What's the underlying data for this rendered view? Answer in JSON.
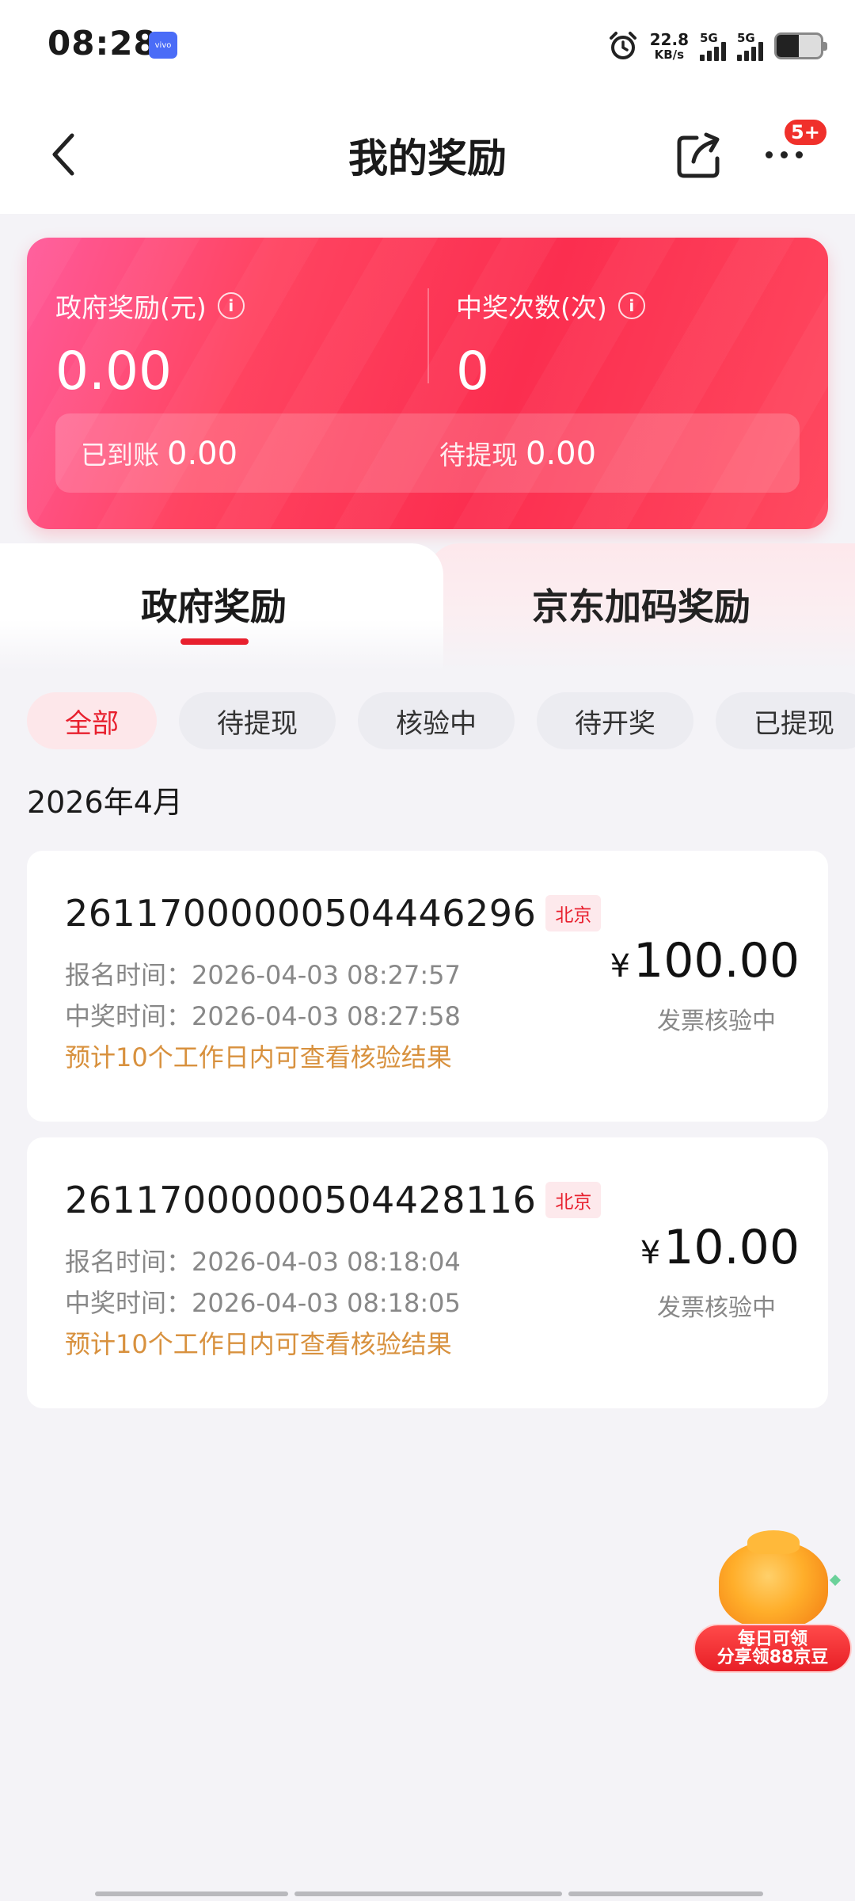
{
  "status_bar": {
    "time": "08:28",
    "brand_badge": "vivo",
    "net_speed_value": "22.8",
    "net_speed_unit": "KB/s",
    "sim1_label": "5G",
    "sim2_label": "5G",
    "battery_level": 0.5
  },
  "header": {
    "title": "我的奖励",
    "notification_badge": "5+",
    "icons": [
      "back-arrow-icon",
      "share-icon",
      "more-icon"
    ]
  },
  "summary": {
    "gov_reward_label": "政府奖励(元)",
    "gov_reward_value": "0.00",
    "win_count_label": "中奖次数(次)",
    "win_count_value": "0",
    "received_label": "已到账",
    "received_value": "0.00",
    "pending_label": "待提现",
    "pending_value": "0.00",
    "info_glyph": "i"
  },
  "tabs": [
    {
      "label": "政府奖励",
      "active": true
    },
    {
      "label": "京东加码奖励",
      "active": false
    }
  ],
  "filters": [
    {
      "label": "全部",
      "active": true
    },
    {
      "label": "待提现",
      "active": false
    },
    {
      "label": "核验中",
      "active": false
    },
    {
      "label": "待开奖",
      "active": false
    },
    {
      "label": "已提现",
      "active": false
    }
  ],
  "month": "2026年4月",
  "records": [
    {
      "id": "26117000000504446296",
      "location": "北京",
      "signup_time": "报名时间：2026-04-03 08:27:57",
      "win_time": "中奖时间：2026-04-03 08:27:58",
      "note": "预计10个工作日内可查看核验结果",
      "currency": "¥",
      "amount": "100.00",
      "status": "发票核验中"
    },
    {
      "id": "26117000000504428116",
      "location": "北京",
      "signup_time": "报名时间：2026-04-03 08:18:04",
      "win_time": "中奖时间：2026-04-03 08:18:05",
      "note": "预计10个工作日内可查看核验结果",
      "currency": "¥",
      "amount": "10.00",
      "status": "发票核验中"
    }
  ],
  "promo": {
    "line1": "每日可领",
    "line2": "分享领88京豆"
  },
  "colors": {
    "accent": "#e8202e",
    "card_gradient_start": "#ff5a9a",
    "card_gradient_end": "#fb2e4f",
    "note": "#d8913e"
  }
}
